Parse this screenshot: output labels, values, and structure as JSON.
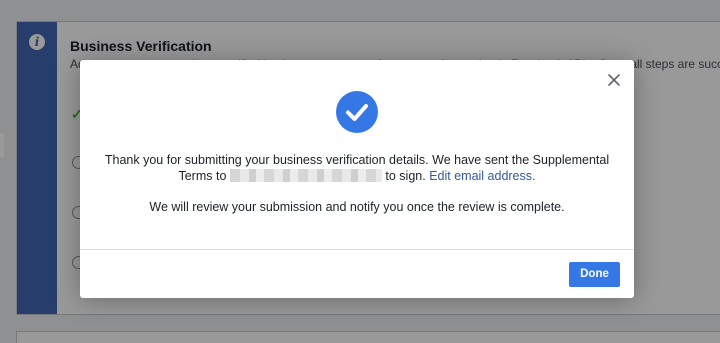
{
  "background": {
    "card_title": "Business Verification",
    "card_description": "Ad accounts connected to a verified business can access features and reporting in Facebook APIs. Once all steps are successful, verification",
    "info_icon": "info-icon",
    "check_icon": "checkmark-icon"
  },
  "modal": {
    "status_icon": "check-circle-icon",
    "message_line1": "Thank you for submitting your business verification details. We have sent the Supplemental",
    "message_terms_prefix": "Terms to",
    "message_terms_suffix": "to sign.",
    "edit_email_link": "Edit email address.",
    "message_review": "We will review your submission and notify you once the review is complete.",
    "done_label": "Done",
    "close_icon": "close-icon"
  },
  "colors": {
    "accent": "#3578e5",
    "sidebar_blue": "#4267b2",
    "link": "#365899",
    "success": "#42b72a"
  }
}
